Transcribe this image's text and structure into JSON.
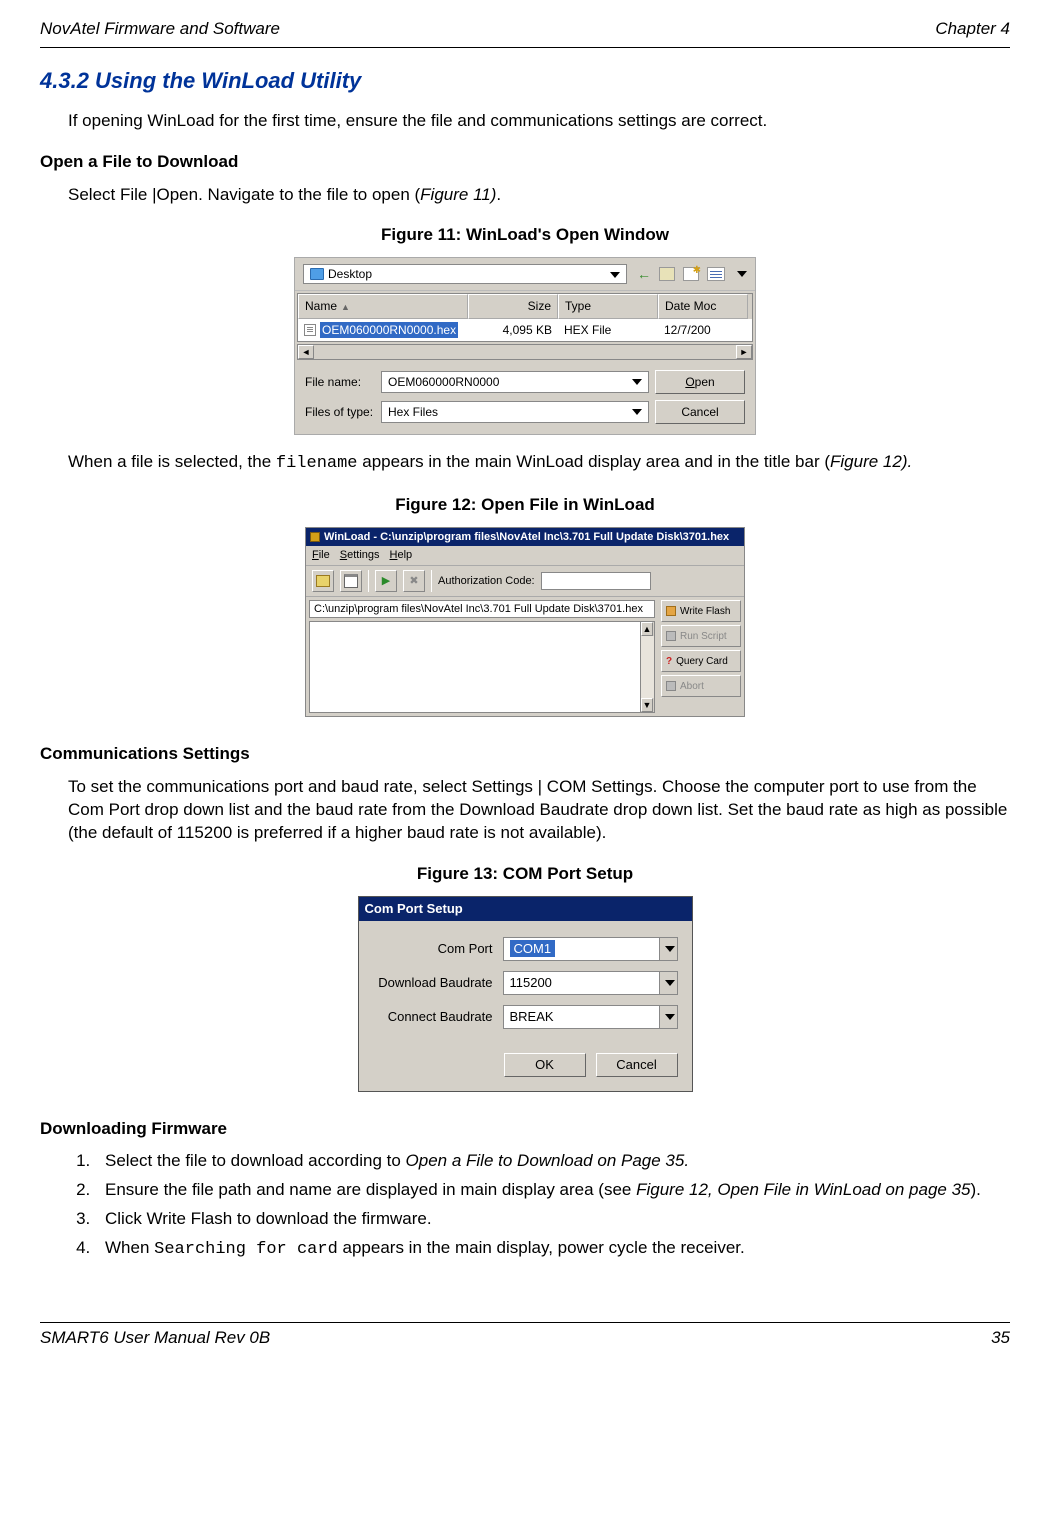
{
  "header": {
    "left": "NovAtel Firmware and Software",
    "right": "Chapter 4"
  },
  "section_title": "4.3.2     Using the WinLoad Utility",
  "intro_text": "If opening WinLoad for the first time, ensure the file and communications settings are correct.",
  "open_file_heading": "Open a File to Download",
  "open_file_para1_a": "Select File |Open. Navigate to the file to open (",
  "open_file_para1_b": "Figure 11)",
  "open_file_para1_c": ".",
  "fig11_caption": "Figure 11: WinLoad's Open Window",
  "fig11": {
    "location": "Desktop",
    "col_name": "Name",
    "col_size": "Size",
    "col_type": "Type",
    "col_date": "Date Moc",
    "row_name": "OEM060000RN0000.hex",
    "row_size": "4,095 KB",
    "row_type": "HEX File",
    "row_date": "12/7/200",
    "filename_label": "File name:",
    "filename_val": "OEM060000RN0000",
    "filetype_label": "Files of type:",
    "filetype_val": "Hex Files",
    "open_btn_pre": "O",
    "open_btn_rest": "pen",
    "cancel_btn": "Cancel"
  },
  "after_fig11_a": "When a file is selected, the ",
  "after_fig11_b": "filename",
  "after_fig11_c": " appears in the main WinLoad display area and in the title bar (",
  "after_fig11_d": "Figure 12).",
  "fig12_caption": "Figure 12: Open File in WinLoad",
  "fig12": {
    "titlebar": "WinLoad - C:\\unzip\\program files\\NovAtel Inc\\3.701 Full Update Disk\\3701.hex",
    "menu_file_u": "F",
    "menu_file_r": "ile",
    "menu_set_u": "S",
    "menu_set_r": "ettings",
    "menu_help_u": "H",
    "menu_help_r": "elp",
    "auth_label": "Authorization Code:",
    "path_text": "C:\\unzip\\program files\\NovAtel Inc\\3.701 Full Update Disk\\3701.hex",
    "btn_write": "Write Flash",
    "btn_run": "Run Script",
    "btn_query": "Query Card",
    "btn_abort": "Abort"
  },
  "comms_heading": "Communications Settings",
  "comms_para": "To set the communications port and baud rate, select Settings | COM Settings. Choose the computer port to use from the Com Port drop down list and the baud rate from the Download Baudrate drop down list. Set the baud rate as high as possible (the default of 115200 is preferred if a higher baud rate is not available).",
  "fig13_caption": "Figure 13: COM Port Setup",
  "fig13": {
    "title": "Com Port Setup",
    "comport_label": "Com Port",
    "comport_val": "COM1",
    "dl_label": "Download Baudrate",
    "dl_val": "115200",
    "connect_label": "Connect Baudrate",
    "connect_val": "BREAK",
    "ok": "OK",
    "cancel": "Cancel"
  },
  "download_heading": "Downloading Firmware",
  "dl_step1_a": "Select the file to download according to ",
  "dl_step1_b": "Open a File to Download on Page 35.",
  "dl_step2_a": "Ensure the file path and name are displayed in main display area (see ",
  "dl_step2_b": "Figure 12, Open File in WinLoad on page 35",
  "dl_step2_c": ").",
  "dl_step3": "Click Write Flash to download the firmware.",
  "dl_step4_a": "When ",
  "dl_step4_b": "Searching for card",
  "dl_step4_c": " appears in the main display, power cycle the receiver.",
  "footer": {
    "left": "SMART6 User Manual Rev 0B",
    "right": "35"
  }
}
